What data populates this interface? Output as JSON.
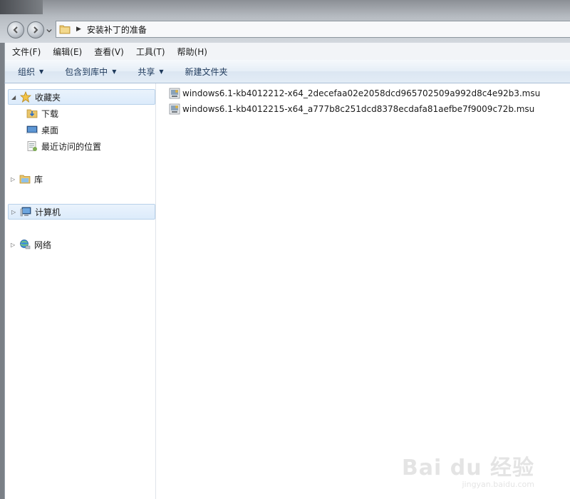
{
  "address": {
    "path": "安装补丁的准备"
  },
  "menu": [
    "文件(F)",
    "编辑(E)",
    "查看(V)",
    "工具(T)",
    "帮助(H)"
  ],
  "commands": {
    "organize": "组织",
    "include_in_library": "包含到库中",
    "share": "共享",
    "new_folder": "新建文件夹"
  },
  "nav": {
    "favorites": "收藏夹",
    "downloads": "下载",
    "desktop": "桌面",
    "recent": "最近访问的位置",
    "libraries": "库",
    "computer": "计算机",
    "network": "网络"
  },
  "files": [
    {
      "name": "windows6.1-kb4012212-x64_2decefaa02e2058dcd965702509a992d8c4e92b3.msu"
    },
    {
      "name": "windows6.1-kb4012215-x64_a777b8c251dcd8378ecdafa81aefbe7f9009c72b.msu"
    }
  ],
  "watermark": {
    "logo": "Bai du 经验",
    "sub": "jingyan.baidu.com"
  },
  "colors": {
    "selected_bg": "#dcebfb",
    "command_text": "#1e395b"
  }
}
